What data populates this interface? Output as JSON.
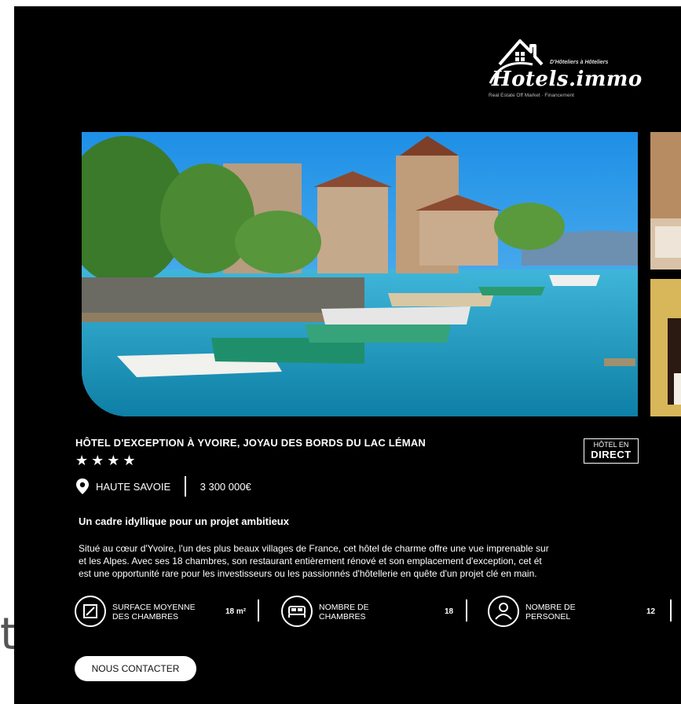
{
  "logo": {
    "kicker": "D'Hôteliers à Hôteliers",
    "brand": "Hotels.immo",
    "tagline": "Real Estate Off Market · Financement"
  },
  "listing": {
    "title": "HÔTEL D'EXCEPTION À YVOIRE, JOYAU DES BORDS DU LAC LÉMAN",
    "stars": "★★★★",
    "star_count": 4,
    "location": "HAUTE SAVOIE",
    "price": "3 300 000€",
    "badge_line1": "HÔTEL EN",
    "badge_line2": "DIRECT",
    "subtitle": "Un cadre idyllique pour un projet ambitieux",
    "description_lines": [
      "Situé au cœur d'Yvoire, l'un des plus beaux villages de France, cet hôtel de charme offre une vue imprenable sur",
      "et les Alpes. Avec ses 18 chambres, son restaurant entièrement rénové et son emplacement d'exception, cet ét",
      "est une opportunité rare pour les investisseurs ou les passionnés d'hôtellerie en quête d'un projet clé en main."
    ]
  },
  "features": [
    {
      "label_line1": "SURFACE MOYENNE",
      "label_line2": "DES CHAMBRES",
      "value": "18 m²",
      "icon": "area-icon"
    },
    {
      "label_line1": "NOMBRE DE",
      "label_line2": "CHAMBRES",
      "value": "18",
      "icon": "bed-icon"
    },
    {
      "label_line1": "NOMBRE DE",
      "label_line2": "PERSONEL",
      "value": "12",
      "icon": "person-icon"
    }
  ],
  "cta": {
    "label": "NOUS CONTACTER"
  },
  "colors": {
    "background": "#000000",
    "text": "#ffffff",
    "button_bg": "#ffffff",
    "button_text": "#111111"
  }
}
